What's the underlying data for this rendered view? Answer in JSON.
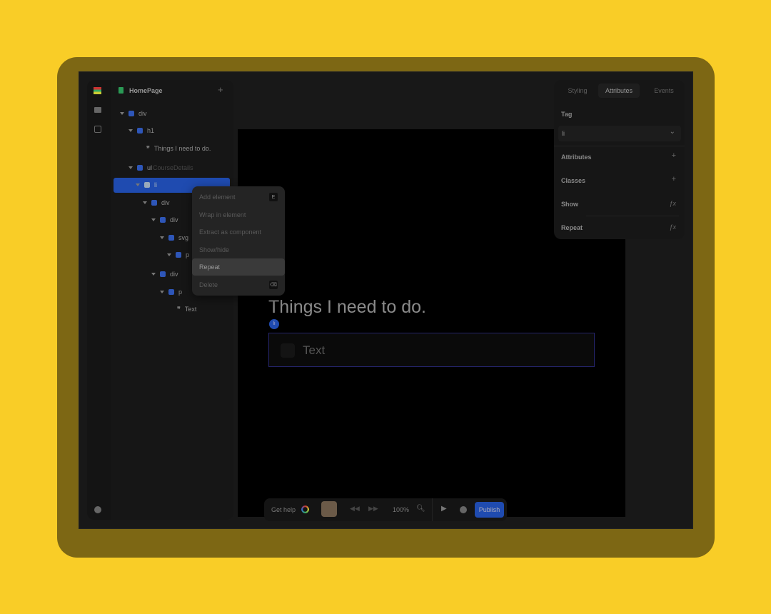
{
  "sidebar": {
    "page_name": "HomePage",
    "add_label": "+"
  },
  "tree": [
    {
      "tag": "div",
      "sub": ""
    },
    {
      "tag": "h1",
      "sub": ""
    },
    {
      "tag": "Things I need to do.",
      "sub": ""
    },
    {
      "tag": "ul",
      "sub": "CourseDetails"
    },
    {
      "tag": "li",
      "sub": ""
    },
    {
      "tag": "div",
      "sub": ""
    },
    {
      "tag": "div",
      "sub": ""
    },
    {
      "tag": "svg",
      "sub": ""
    },
    {
      "tag": "p",
      "sub": ""
    },
    {
      "tag": "div",
      "sub": ""
    },
    {
      "tag": "p",
      "sub": ""
    },
    {
      "tag": "Text",
      "sub": ""
    }
  ],
  "context_menu": [
    {
      "label": "Add element",
      "shortcut": "E"
    },
    {
      "label": "Wrap in element"
    },
    {
      "label": "Extract as component"
    },
    {
      "label": "Show/hide"
    },
    {
      "label": "Repeat"
    },
    {
      "label": "Delete",
      "shortcut": "⌫"
    }
  ],
  "canvas": {
    "heading": "Things I need to do.",
    "badge": "li",
    "item_text": "Text"
  },
  "right_panel": {
    "tabs": [
      "Styling",
      "Attributes",
      "Events"
    ],
    "active_tab": "Attributes",
    "tag_label": "Tag",
    "tag_value": "li",
    "attributes_label": "Attributes",
    "classes_label": "Classes",
    "show_label": "Show",
    "repeat_label": "Repeat",
    "fx": "ƒx"
  },
  "toolbar": {
    "help": "Get help",
    "zoom": "100%",
    "publish": "Publish"
  },
  "colors": {
    "background": "#F9CD27",
    "accent": "#1f4bb0"
  }
}
